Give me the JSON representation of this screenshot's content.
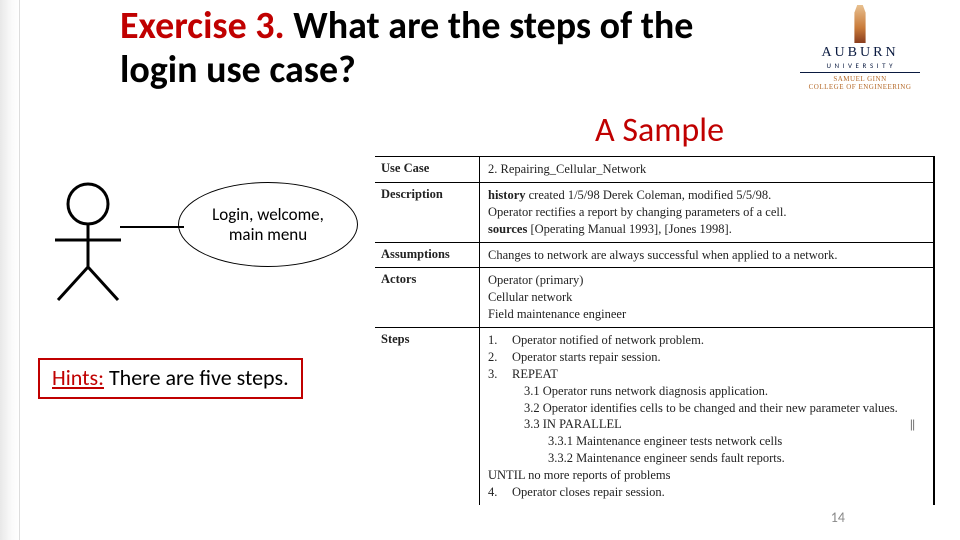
{
  "title_accent": "Exercise 3.",
  "title_rest": " What are the steps of the login use case?",
  "sample_label": "A Sample",
  "logo": {
    "name": "AUBURN",
    "univ": "U N I V E R S I T Y",
    "college_line1": "SAMUEL GINN",
    "college_line2": "COLLEGE OF ENGINEERING"
  },
  "bubble_text": "Login, welcome, main menu",
  "hints_label": "Hints:",
  "hints_text": " There are five steps.",
  "table": {
    "use_case_label": "Use Case",
    "use_case_value": "2. Repairing_Cellular_Network",
    "description_label": "Description",
    "history": "history created 1/5/98 Derek Coleman, modified 5/5/98.",
    "desc_text": "Operator rectifies a report by changing parameters of a cell.",
    "sources": "sources [Operating Manual 1993], [Jones 1998].",
    "assumptions_label": "Assumptions",
    "assumptions_value": "Changes to network are always successful when applied to a network.",
    "actors_label": "Actors",
    "actor1": "Operator  (primary)",
    "actor2": "Cellular network",
    "actor3": "Field maintenance engineer",
    "steps_label": "Steps",
    "step1_no": "1.",
    "step1": "Operator notified of network problem.",
    "step2_no": "2.",
    "step2": "Operator starts repair session.",
    "step3_no": "3.",
    "step3": "REPEAT",
    "step31": "3.1 Operator runs network diagnosis application.",
    "step32": "3.2 Operator identifies cells to be changed and their new parameter values.",
    "step33": "3.3 IN PARALLEL",
    "step331": "3.3.1 Maintenance engineer tests network cells",
    "step332": "3.3.2 Maintenance engineer sends fault reports.",
    "parallel_close": "||",
    "until": "UNTIL no more reports of problems",
    "step4_no": "4.",
    "step4": "Operator closes repair session."
  },
  "page_number": "14"
}
